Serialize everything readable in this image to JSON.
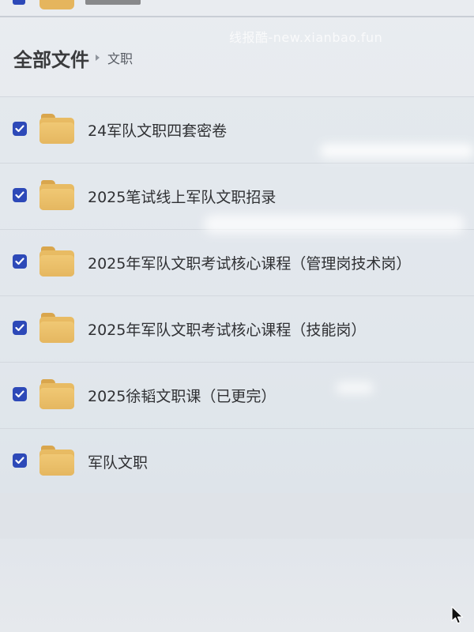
{
  "watermark": "线报酷-new.xianbao.fun",
  "breadcrumb": {
    "root": "全部文件",
    "current": "文职"
  },
  "files": [
    {
      "name": "24军队文职四套密卷",
      "type": "folder",
      "checked": true
    },
    {
      "name": "2025笔试线上军队文职招录",
      "type": "folder",
      "checked": true
    },
    {
      "name": "2025年军队文职考试核心课程（管理岗技术岗）",
      "type": "folder",
      "checked": true
    },
    {
      "name": "2025年军队文职考试核心课程（技能岗）",
      "type": "folder",
      "checked": true
    },
    {
      "name": "2025徐韬文职课（已更完）",
      "type": "folder",
      "checked": true
    },
    {
      "name": "军队文职",
      "type": "folder",
      "checked": true
    }
  ],
  "colors": {
    "checkbox": "#2d49b8",
    "folder": "#e9bc64",
    "background": "#e6e9ed"
  },
  "icons": {
    "folder": "folder-icon",
    "check": "check-icon",
    "cursor": "mouse-cursor-icon"
  }
}
